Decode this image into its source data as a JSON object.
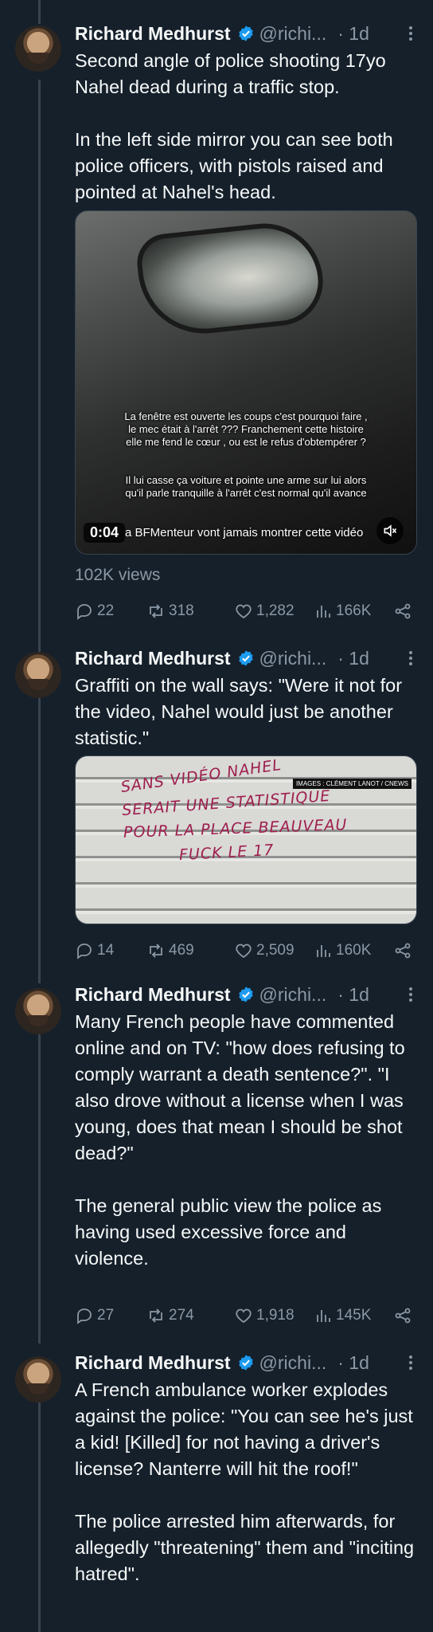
{
  "author": {
    "name": "Richard Medhurst",
    "handle": "@richi...",
    "time": "· 1d"
  },
  "tweets": [
    {
      "text": "Second angle of police shooting 17yo Nahel dead during a traffic stop.\n\nIn the left side mirror you can see both police officers, with pistols raised and pointed at Nahel's head.",
      "media": {
        "type": "video",
        "subtitle_1": "La fenêtre est ouverte les coups c'est pourquoi faire ,\nle mec était à l'arrêt ??? Franchement cette histoire\nelle me fend le cœur , ou est le refus d'obtempérer ?",
        "subtitle_2": "Il lui casse ça voiture et pointe une arme sur lui alors\nqu'il parle tranquille à l'arrêt c'est normal qu'il avance",
        "time": "0:04",
        "caption": "a BFMenteur vont jamais montrer cette vidéo"
      },
      "views": "102K views",
      "replies": "22",
      "reposts": "318",
      "likes": "1,282",
      "analytics": "166K"
    },
    {
      "text": "Graffiti on the wall says: \"Were it not for the video, Nahel would just be another statistic.\"",
      "media": {
        "type": "image",
        "credit": "IMAGES : CLÉMENT LANOT / CNEWS",
        "graffiti": [
          "SANS VIDÉO NAHEL",
          "SERAIT UNE STATISTIQUE",
          "POUR LA PLACE BEAUVEAU",
          "FUCK LE 17"
        ]
      },
      "replies": "14",
      "reposts": "469",
      "likes": "2,509",
      "analytics": "160K"
    },
    {
      "text": "Many French people have commented online and on TV: \"how does refusing to comply warrant a death sentence?\". \"I also drove without a license when I was young, does that mean I should be shot dead?\"\n\nThe general public view the police as having used excessive force and violence.",
      "replies": "27",
      "reposts": "274",
      "likes": "1,918",
      "analytics": "145K"
    },
    {
      "text": "A French ambulance worker explodes against the police: \"You can see he's just a kid! [Killed] for not having a driver's license? Nanterre will hit the roof!\"\n\nThe police arrested him afterwards, for allegedly \"threatening\" them and \"inciting hatred\"."
    }
  ],
  "colors": {
    "background": "#15202b",
    "text": "#f7f9f9",
    "muted": "#8b98a5",
    "verified": "#1d9bf0",
    "thread_line": "#38444d"
  },
  "icons": [
    "verified-badge-icon",
    "more-icon",
    "reply-icon",
    "repost-icon",
    "like-icon",
    "analytics-icon",
    "share-icon",
    "mute-icon"
  ]
}
